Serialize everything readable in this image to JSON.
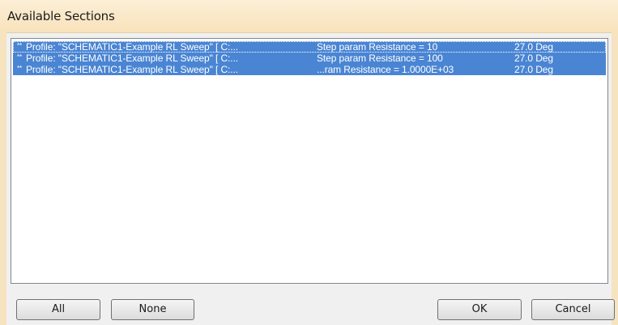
{
  "window": {
    "title": "Available Sections"
  },
  "sections": {
    "items": [
      {
        "prefix": "**",
        "profile": "Profile: \"SCHEMATIC1-Example RL Sweep\"  [ C:...",
        "step": "Step param Resistance =  10",
        "temp": "27.0 Deg",
        "selected": true
      },
      {
        "prefix": "**",
        "profile": "Profile: \"SCHEMATIC1-Example RL Sweep\"  [ C:...",
        "step": "Step param Resistance =  100",
        "temp": "27.0 Deg",
        "selected": true
      },
      {
        "prefix": "**",
        "profile": "Profile: \"SCHEMATIC1-Example RL Sweep\"  [ C:...",
        "step": "...ram Resistance =   1.0000E+03",
        "temp": "27.0 Deg",
        "selected": true
      }
    ]
  },
  "buttons": {
    "all": "All",
    "none": "None",
    "ok": "OK",
    "cancel": "Cancel"
  },
  "colors": {
    "selection": "#4a85d3",
    "titlebar": "#f8e2bb",
    "dialog_bg": "#f0f0f0"
  }
}
